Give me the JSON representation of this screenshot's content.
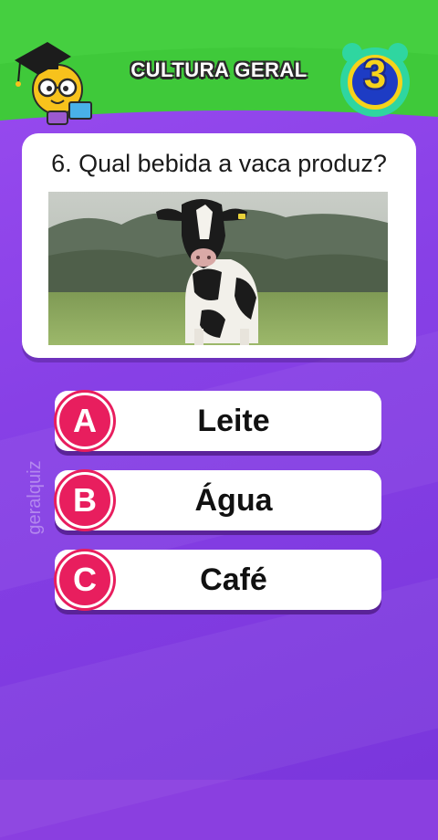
{
  "header": {
    "title": "CULTURA GERAL",
    "timer_value": "3",
    "mascot_icon": "lightbulb-graduate-mascot-icon",
    "timer_icon": "alarm-clock-icon"
  },
  "question": {
    "text": "6. Qual bebida a vaca produz?",
    "image": "holstein-cow-in-field-photo"
  },
  "answers": [
    {
      "letter": "A",
      "label": "Leite"
    },
    {
      "letter": "B",
      "label": "Água"
    },
    {
      "letter": "C",
      "label": "Café"
    }
  ],
  "watermark": "geralquiz",
  "colors": {
    "header_green": "#3fc93a",
    "background_purple": "#8a3fe0",
    "answer_badge": "#e81e5e",
    "timer_ring": "#2fd6a0",
    "timer_number": "#f6d31a"
  }
}
